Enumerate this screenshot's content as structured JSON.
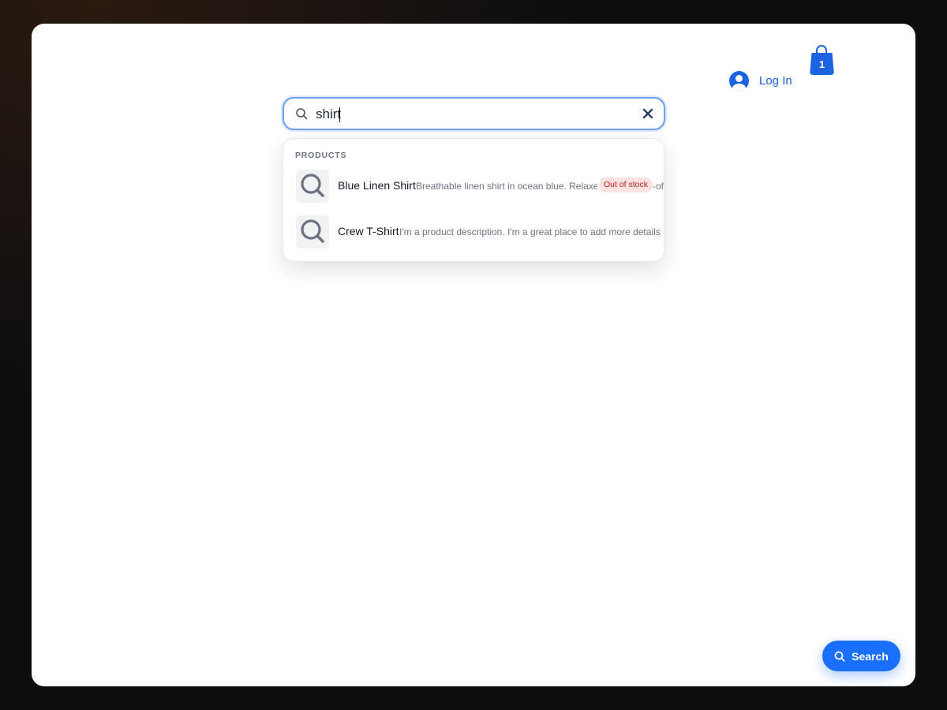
{
  "header": {
    "login_label": "Log In",
    "cart_count": "1"
  },
  "search": {
    "query": "shirt",
    "placeholder": ""
  },
  "dropdown": {
    "section_title": "PRODUCTS",
    "results": [
      {
        "name": "Blue Linen Shirt",
        "description": "Breathable linen shirt in ocean blue. Relaxed",
        "description_tail": "-of-",
        "badge": "Out of stock"
      },
      {
        "name": "Crew T-Shirt",
        "description": "I'm a product description. I'm a great place to add more details"
      }
    ]
  },
  "fab": {
    "label": "Search"
  },
  "colors": {
    "accent": "#1b63e0",
    "fab": "#1b6fff",
    "badge_bg": "#fde2e2",
    "badge_text": "#b42318"
  }
}
